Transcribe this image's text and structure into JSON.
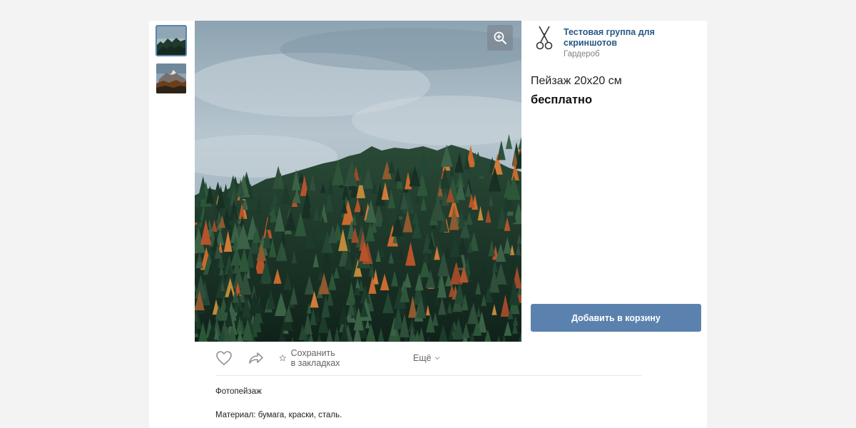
{
  "group": {
    "name": "Тестовая группа для скриншотов",
    "category": "Гардероб",
    "logo_icon": "scissors-icon"
  },
  "product": {
    "title": "Пейзаж 20х20 см",
    "price": "бесплатно",
    "add_to_cart_label": "Добавить в корзину",
    "description_title": "Фотопейзаж",
    "description_material": "Материал: бумага, краски, сталь."
  },
  "gallery": {
    "thumbnails": [
      {
        "icon": "forest-thumbnail",
        "active": true
      },
      {
        "icon": "mountain-thumbnail",
        "active": false
      }
    ],
    "zoom_icon": "zoom-in-icon"
  },
  "actions": {
    "like_icon": "heart-icon",
    "share_icon": "share-arrow-icon",
    "bookmark_icon": "star-icon",
    "bookmark_label": "Сохранить в закладках",
    "more_label": "Ещё",
    "more_icon": "chevron-down-icon"
  },
  "colors": {
    "accent_button": "#5b82ae",
    "link": "#2a5885",
    "muted_text": "#828282",
    "background": "#f3f3f3"
  }
}
